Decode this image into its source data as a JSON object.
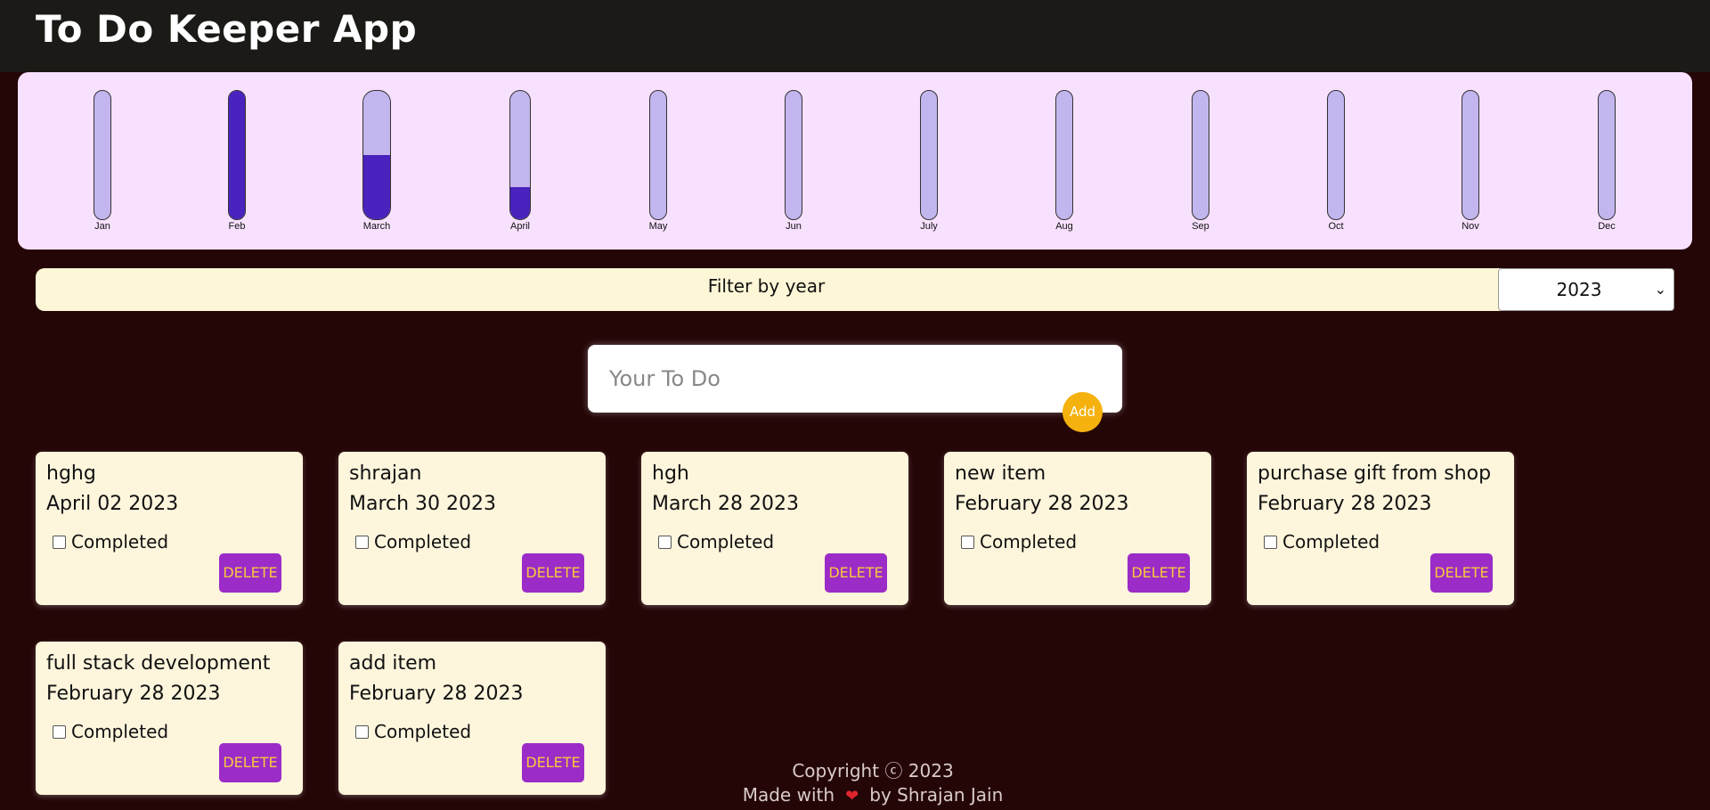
{
  "header": {
    "title": "To Do Keeper App"
  },
  "chart_data": {
    "type": "bar",
    "categories": [
      "Jan",
      "Feb",
      "March",
      "April",
      "May",
      "Jun",
      "July",
      "Aug",
      "Sep",
      "Oct",
      "Nov",
      "Dec"
    ],
    "values": [
      0,
      1,
      0.5,
      0.25,
      0,
      0,
      0,
      0,
      0,
      0,
      0,
      0
    ],
    "ylim": [
      0,
      1
    ],
    "colors": {
      "fill": "#4a22bd",
      "track": "#c3b6ef"
    }
  },
  "filter": {
    "label": "Filter by year",
    "selected_year": "2023"
  },
  "input": {
    "placeholder": "Your To Do",
    "add_label": "Add"
  },
  "notes": [
    {
      "title": "hghg",
      "date": "April 02 2023",
      "completed_label": "Completed",
      "delete_label": "DELETE"
    },
    {
      "title": "shrajan",
      "date": "March 30 2023",
      "completed_label": "Completed",
      "delete_label": "DELETE"
    },
    {
      "title": "hgh",
      "date": "March 28 2023",
      "completed_label": "Completed",
      "delete_label": "DELETE"
    },
    {
      "title": "new item",
      "date": "February 28 2023",
      "completed_label": "Completed",
      "delete_label": "DELETE"
    },
    {
      "title": "purchase gift from shop",
      "date": "February 28 2023",
      "completed_label": "Completed",
      "delete_label": "DELETE"
    },
    {
      "title": "full stack development",
      "date": "February 28 2023",
      "completed_label": "Completed",
      "delete_label": "DELETE"
    },
    {
      "title": "add item",
      "date": "February 28 2023",
      "completed_label": "Completed",
      "delete_label": "DELETE"
    }
  ],
  "footer": {
    "copyright": "Copyright ⓒ 2023",
    "made_with": "Made with",
    "by": "by Shrajan Jain"
  }
}
